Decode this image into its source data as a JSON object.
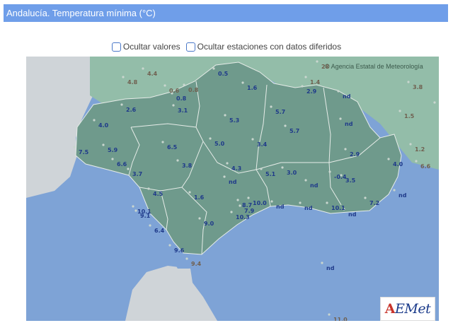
{
  "header": {
    "title": "Andalucía. Temperatura mínima (°C)"
  },
  "options": [
    {
      "label": "Ocultar valores"
    },
    {
      "label": "Ocultar estaciones con datos diferidos"
    }
  ],
  "map": {
    "attribution": "© Agencia Estatal de Meteorología",
    "colors": {
      "sea": "#7ea3d6",
      "land_other": "#cfd4d8",
      "region": "#6f9a8c",
      "neighbor": "#93bda9",
      "border": "#e6ece8",
      "value_in": "#1f3a8a",
      "value_out": "#706050"
    },
    "values": [
      {
        "text": "4.4",
        "outside": true
      },
      {
        "text": "4.8",
        "outside": true
      },
      {
        "text": "0.6",
        "outside": true
      },
      {
        "text": "0.8",
        "outside": true
      },
      {
        "text": "0.5",
        "outside": false
      },
      {
        "text": "28",
        "outside": true
      },
      {
        "text": "1.4",
        "outside": true
      },
      {
        "text": "3.8",
        "outside": true
      },
      {
        "text": "1.6",
        "outside": false
      },
      {
        "text": "2.9",
        "outside": false
      },
      {
        "text": "nd",
        "outside": false
      },
      {
        "text": "0.8",
        "outside": false
      },
      {
        "text": "2.6",
        "outside": false
      },
      {
        "text": "3.1",
        "outside": false
      },
      {
        "text": "5.7",
        "outside": false
      },
      {
        "text": "1.5",
        "outside": true
      },
      {
        "text": "1.3",
        "outside": true
      },
      {
        "text": "5.3",
        "outside": false
      },
      {
        "text": "4.0",
        "outside": false
      },
      {
        "text": "nd",
        "outside": false
      },
      {
        "text": "5.7",
        "outside": false
      },
      {
        "text": "7.5",
        "outside": false
      },
      {
        "text": "5.9",
        "outside": false
      },
      {
        "text": "6.5",
        "outside": false
      },
      {
        "text": "5.0",
        "outside": false
      },
      {
        "text": "3.4",
        "outside": false
      },
      {
        "text": "2.9",
        "outside": false
      },
      {
        "text": "1.2",
        "outside": true
      },
      {
        "text": "6.6",
        "outside": false
      },
      {
        "text": "3.8",
        "outside": false
      },
      {
        "text": "4.3",
        "outside": false
      },
      {
        "text": "4.0",
        "outside": false
      },
      {
        "text": "6.6",
        "outside": true
      },
      {
        "text": "3.7",
        "outside": false
      },
      {
        "text": "5.1",
        "outside": false
      },
      {
        "text": "3.0",
        "outside": false
      },
      {
        "text": "nd",
        "outside": false
      },
      {
        "text": "-0.4",
        "outside": false
      },
      {
        "text": "3.5",
        "outside": false
      },
      {
        "text": "nd",
        "outside": false
      },
      {
        "text": "nd",
        "outside": false
      },
      {
        "text": "4.5",
        "outside": false
      },
      {
        "text": "1.6",
        "outside": false
      },
      {
        "text": "10.0",
        "outside": false
      },
      {
        "text": "nd",
        "outside": false
      },
      {
        "text": "8.7",
        "outside": false
      },
      {
        "text": "7.9",
        "outside": false
      },
      {
        "text": "nd",
        "outside": false
      },
      {
        "text": "10.1",
        "outside": false
      },
      {
        "text": "7.2",
        "outside": false
      },
      {
        "text": "10.1",
        "outside": false
      },
      {
        "text": "9.1",
        "outside": false
      },
      {
        "text": "10.3",
        "outside": false
      },
      {
        "text": "nd",
        "outside": false
      },
      {
        "text": "9.0",
        "outside": false
      },
      {
        "text": "6.4",
        "outside": false
      },
      {
        "text": "9.6",
        "outside": false
      },
      {
        "text": "9.4",
        "outside": true
      },
      {
        "text": "nd",
        "outside": false
      },
      {
        "text": "11.0",
        "outside": true
      }
    ]
  },
  "logo": {
    "text": "AEMET"
  }
}
